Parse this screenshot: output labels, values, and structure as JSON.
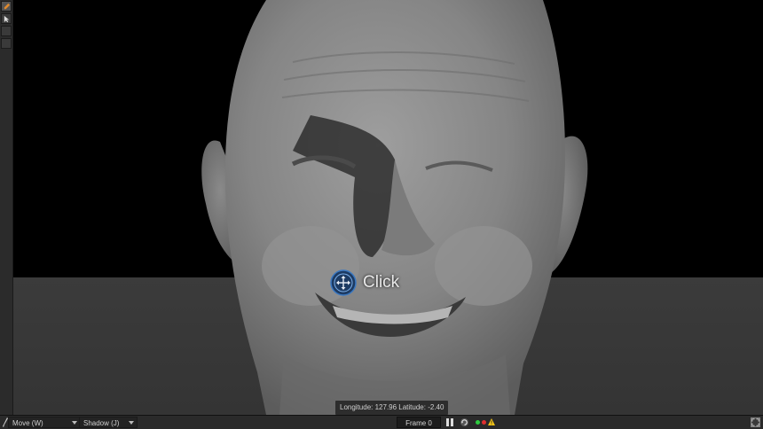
{
  "viewport": {
    "click_label": "Click",
    "coordinates": "Longitude: 127.96 Latitude: -2.40"
  },
  "toolbar": {
    "items": [
      {
        "icon": "brush-icon",
        "active": true
      },
      {
        "icon": "select-arrow-icon",
        "active": false
      },
      {
        "icon": "blank-tool-icon",
        "active": false
      },
      {
        "icon": "blank-tool-icon",
        "active": false
      }
    ]
  },
  "bottom_bar": {
    "tool_select": "Move (W)",
    "shadow_select": "Shadow (J)",
    "frame": "Frame 0",
    "status_colors": [
      "#2ecc40",
      "#e03030",
      "#f5c518"
    ]
  }
}
